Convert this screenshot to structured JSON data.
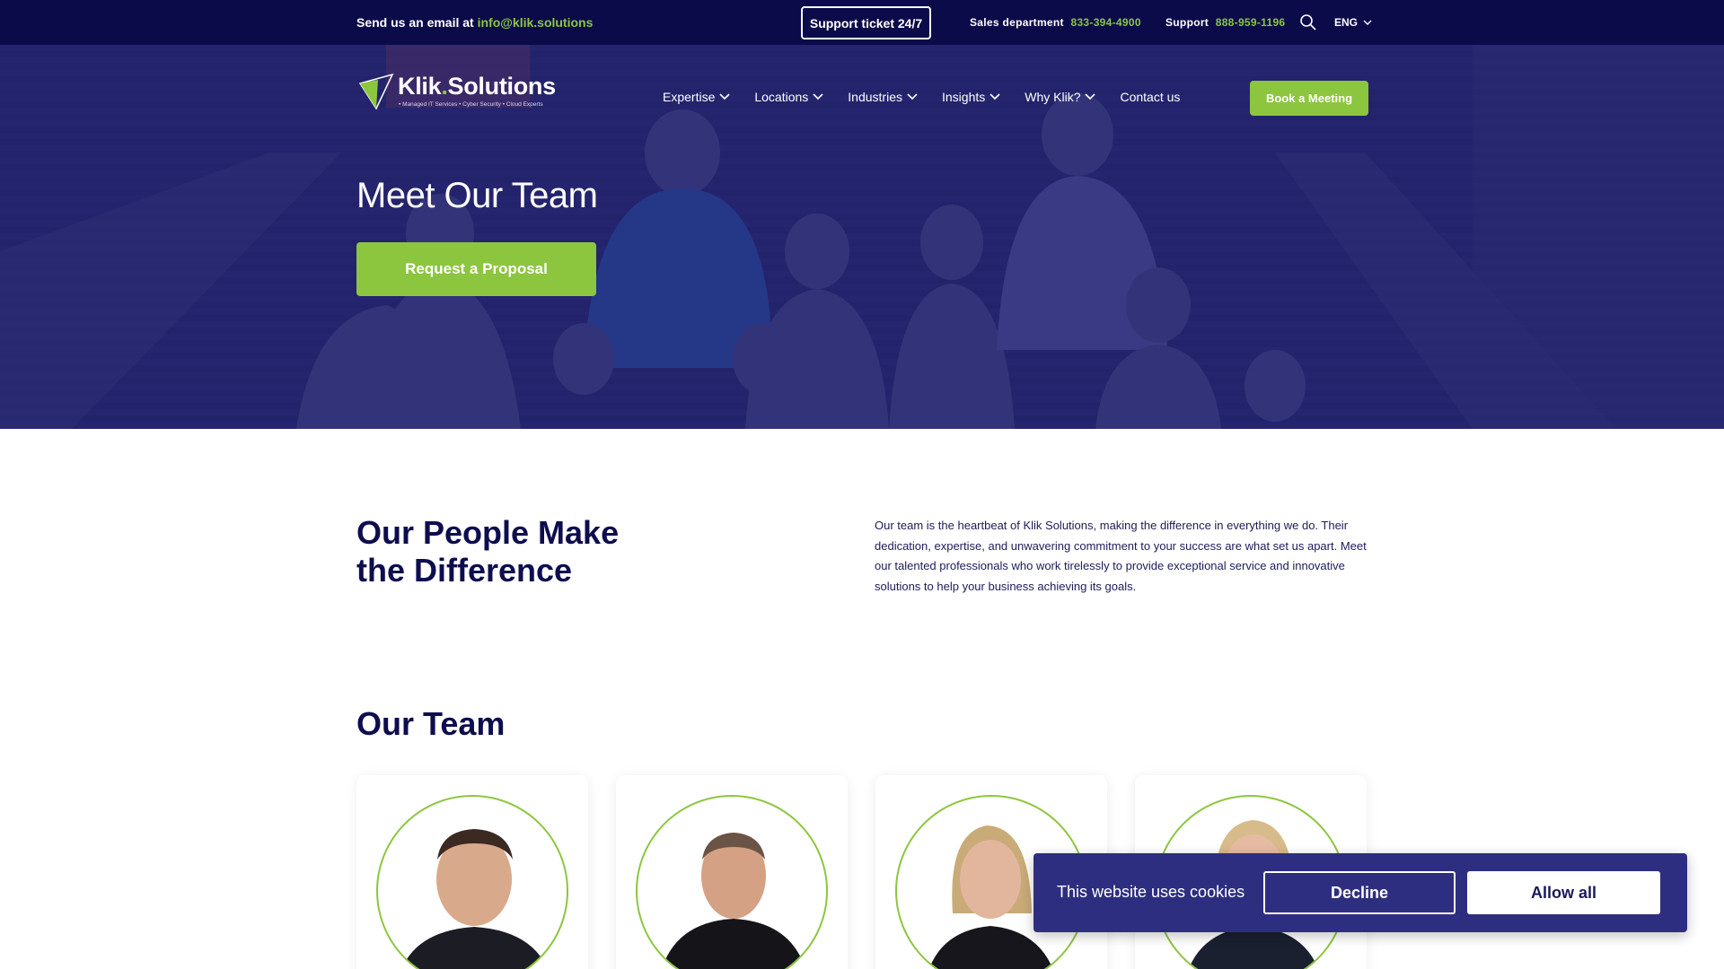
{
  "topbar": {
    "email_prefix": "Send us an email at",
    "email": "info@klik.solutions",
    "ticket_label": "Support ticket 24/7",
    "sales_label": "Sales department",
    "sales_phone": "833-394-4900",
    "support_label": "Support",
    "support_phone": "888-959-1196",
    "search_icon": "search-icon",
    "language": "ENG"
  },
  "logo": {
    "brand_a": "Klik",
    "brand_dot": ".",
    "brand_b": "Solutions",
    "tagline": "• Managed IT Services • Cyber Security • Cloud Experts"
  },
  "nav": {
    "items": [
      {
        "label": "Expertise",
        "has_dropdown": true
      },
      {
        "label": "Locations",
        "has_dropdown": true
      },
      {
        "label": "Industries",
        "has_dropdown": true
      },
      {
        "label": "Insights",
        "has_dropdown": true
      },
      {
        "label": "Why Klik?",
        "has_dropdown": true
      },
      {
        "label": "Contact us",
        "has_dropdown": false
      }
    ],
    "cta": "Book a Meeting"
  },
  "hero": {
    "title": "Meet Our Team",
    "button": "Request a Proposal"
  },
  "intro": {
    "title_line1": "Our People Make",
    "title_line2": "the Difference",
    "text": "Our team is the heartbeat of Klik Solutions, making the difference in everything we do. Their dedication, expertise, and unwavering commitment to your success are what set us apart. Meet our talented professionals who work tirelessly to provide exceptional service and innovative solutions to help your business achieving its goals."
  },
  "team": {
    "title": "Our Team",
    "members": [
      {
        "photo": "team-member-photo"
      },
      {
        "photo": "team-member-photo"
      },
      {
        "photo": "team-member-photo"
      },
      {
        "photo": "team-member-photo"
      }
    ]
  },
  "cookie": {
    "message": "This website uses cookies",
    "decline": "Decline",
    "allow": "Allow all"
  },
  "colors": {
    "navy": "#0b0b4a",
    "accent_green": "#8cc63f",
    "hero_overlay": "#20206e",
    "cookie_bg": "#2e2e80"
  }
}
